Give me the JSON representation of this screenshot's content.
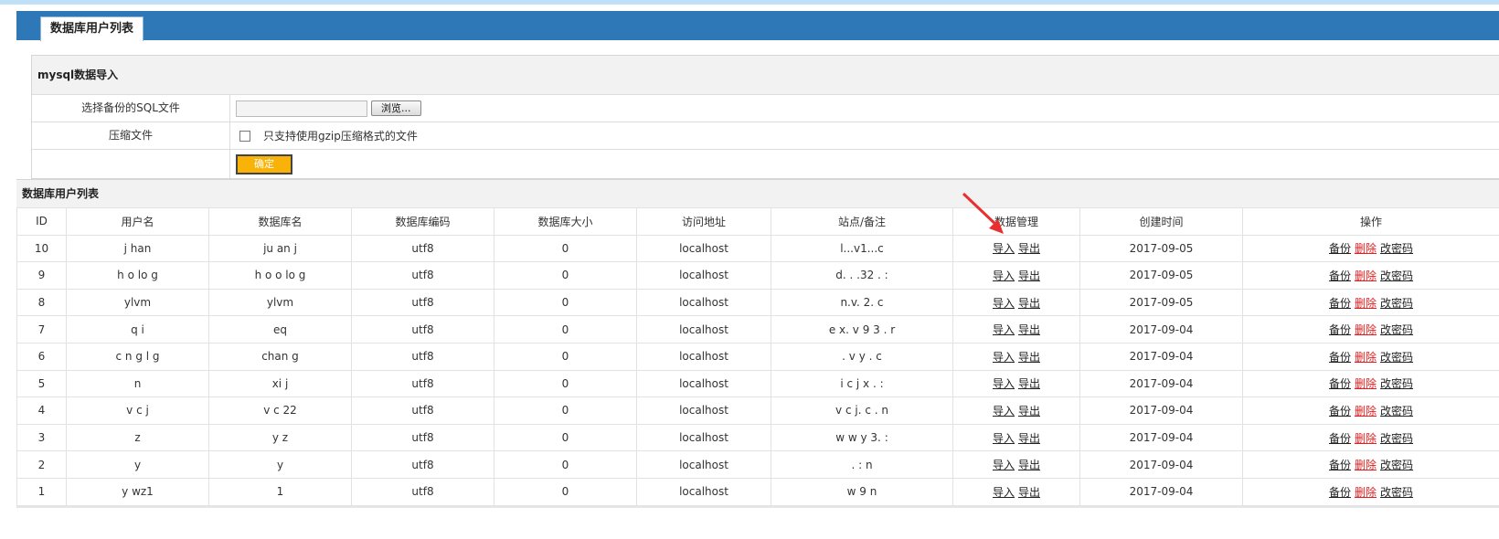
{
  "page": {
    "tab_title": "数据库用户列表"
  },
  "import_form": {
    "header": "mysql数据导入",
    "file_label": "选择备份的SQL文件",
    "browse_label": "浏览...",
    "compress_label": "压缩文件",
    "compress_hint": "只支持使用gzip压缩格式的文件",
    "confirm_label": "确定"
  },
  "list": {
    "header": "数据库用户列表",
    "columns": [
      "ID",
      "用户名",
      "数据库名",
      "数据库编码",
      "数据库大小",
      "访问地址",
      "站点/备注",
      "数据管理",
      "创建时间",
      "操作"
    ],
    "manage_links": {
      "import": "导入",
      "export": "导出"
    },
    "op_links": {
      "backup": "备份",
      "delete": "删除",
      "change_pwd": "改密码"
    },
    "rows": [
      {
        "id": "10",
        "user": "j  han",
        "db": "ju  an  j",
        "enc": "utf8",
        "size": "0",
        "host": "localhost",
        "note": "l...v1...c",
        "date": "2017-09-05"
      },
      {
        "id": "9",
        "user": "h  o lo g",
        "db": "h o o lo g",
        "enc": "utf8",
        "size": "0",
        "host": "localhost",
        "note": "d. .  .32 . :",
        "date": "2017-09-05"
      },
      {
        "id": "8",
        "user": "ylvm",
        "db": "ylvm",
        "enc": "utf8",
        "size": "0",
        "host": "localhost",
        "note": "n.v. 2. c",
        "date": "2017-09-05"
      },
      {
        "id": "7",
        "user": "q i",
        "db": "eq",
        "enc": "utf8",
        "size": "0",
        "host": "localhost",
        "note": "e  x. v 9 3 . r",
        "date": "2017-09-04"
      },
      {
        "id": "6",
        "user": "c  n g l  g",
        "db": "chan  g",
        "enc": "utf8",
        "size": "0",
        "host": "localhost",
        "note": ". v y .  c",
        "date": "2017-09-04"
      },
      {
        "id": "5",
        "user": "n",
        "db": "xi  j",
        "enc": "utf8",
        "size": "0",
        "host": "localhost",
        "note": "i  c j  x . :",
        "date": "2017-09-04"
      },
      {
        "id": "4",
        "user": "v c j",
        "db": "v c 22",
        "enc": "utf8",
        "size": "0",
        "host": "localhost",
        "note": "v c j.  c .  n",
        "date": "2017-09-04"
      },
      {
        "id": "3",
        "user": "z",
        "db": "y  z",
        "enc": "utf8",
        "size": "0",
        "host": "localhost",
        "note": "w w  y  3. :",
        "date": "2017-09-04"
      },
      {
        "id": "2",
        "user": "y",
        "db": "y",
        "enc": "utf8",
        "size": "0",
        "host": "localhost",
        "note": ". :  n",
        "date": "2017-09-04"
      },
      {
        "id": "1",
        "user": "y  wz1",
        "db": "1",
        "enc": "utf8",
        "size": "0",
        "host": "localhost",
        "note": "w  9 n",
        "date": "2017-09-04"
      }
    ]
  },
  "colors": {
    "title_bar": "#2f78b8",
    "confirm_button": "#f9b208",
    "delete_link": "#e02020",
    "arrow": "#e83030"
  }
}
